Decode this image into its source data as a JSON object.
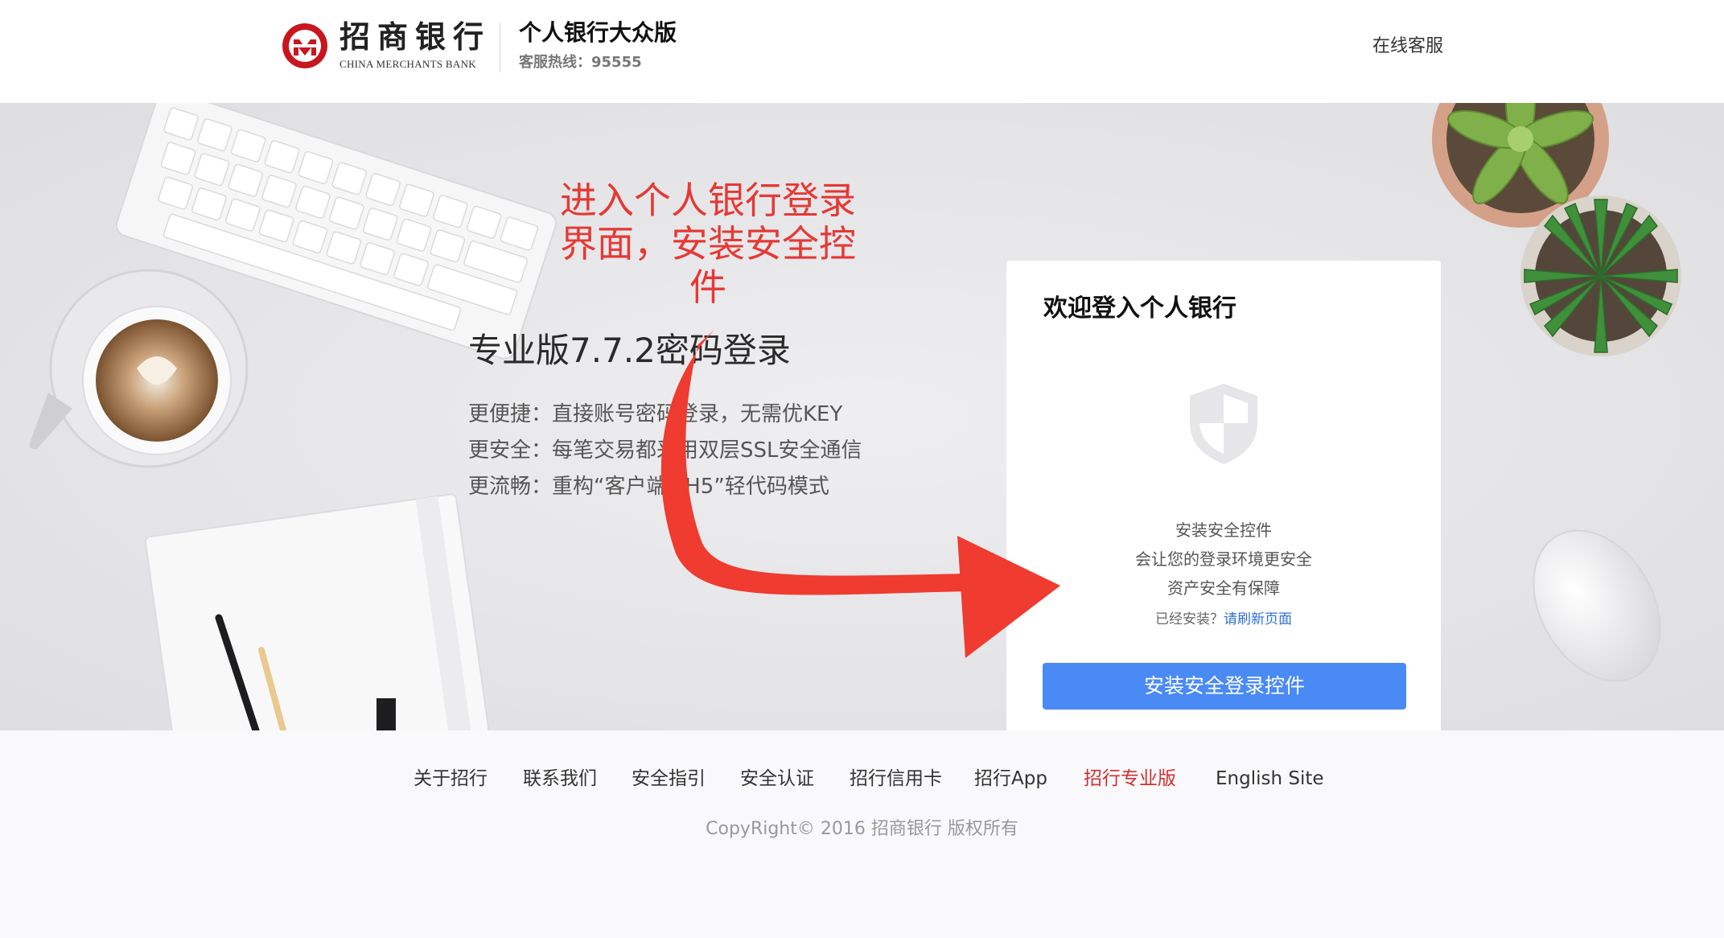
{
  "header": {
    "logo_cn": "招商银行",
    "logo_en": "CHINA MERCHANTS BANK",
    "title": "个人银行大众版",
    "hotline": "客服热线：95555",
    "online_service": "在线客服"
  },
  "promo": {
    "title": "专业版7.7.2密码登录",
    "lines": [
      "更便捷：直接账号密码登录，无需优KEY",
      "更安全：每笔交易都采用双层SSL安全通信",
      "更流畅：重构“客户端+H5”轻代码模式"
    ]
  },
  "annotation": {
    "lines": [
      "进入个人银行登录",
      "界面，安装安全控",
      "件"
    ],
    "color": "#e53935"
  },
  "login": {
    "title": "欢迎登入个人银行",
    "icon": "shield-icon",
    "info_lines": [
      "安装安全控件",
      "会让您的登录环境更安全",
      "资产安全有保障"
    ],
    "installed_hint": "已经安装？",
    "refresh_link": "请刷新页面",
    "install_button": "安装安全登录控件",
    "button_color": "#4a8af4"
  },
  "footer": {
    "links": [
      {
        "label": "关于招行",
        "active": false
      },
      {
        "label": "联系我们",
        "active": false
      },
      {
        "label": "安全指引",
        "active": false
      },
      {
        "label": "安全认证",
        "active": false
      },
      {
        "label": "招行信用卡",
        "active": false
      },
      {
        "label": "招行App",
        "active": false
      },
      {
        "label": "招行专业版",
        "active": true
      },
      {
        "label": "English Site",
        "active": false
      }
    ],
    "copyright": "CopyRight© 2016 招商银行 版权所有",
    "active_color": "#d32f2f"
  },
  "brand_color": "#c8161e"
}
